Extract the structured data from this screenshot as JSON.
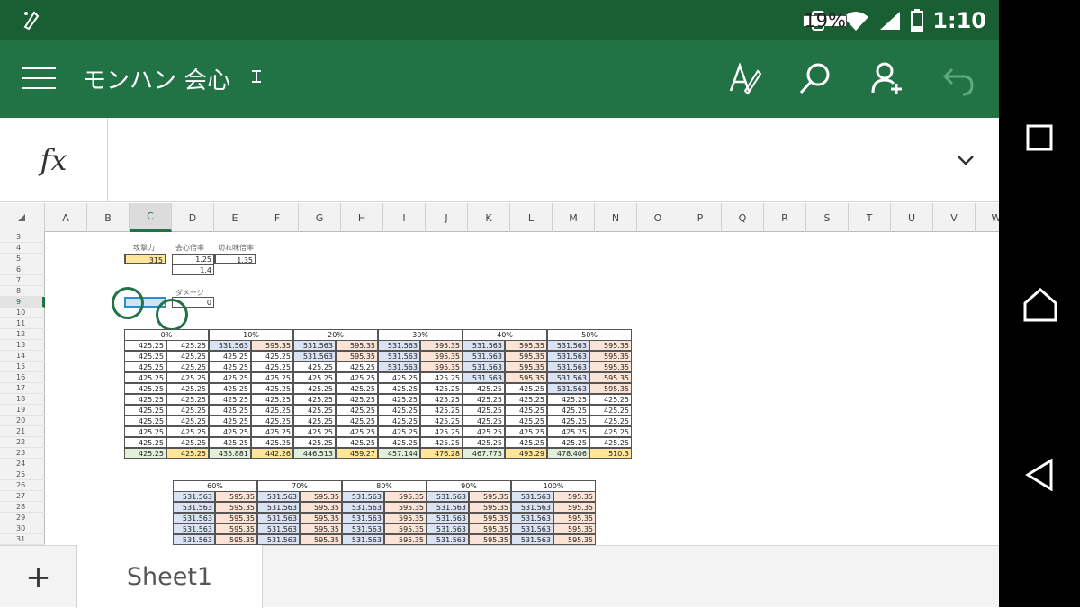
{
  "status_bar": {
    "battery_percent": "19%",
    "time": "1:10"
  },
  "app_bar": {
    "title": "モンハン 会心",
    "title_icon": "text-cursor-icon"
  },
  "toolbar": {
    "icons": [
      "draw-pen-icon",
      "search-icon",
      "share-person-icon",
      "undo-icon"
    ]
  },
  "formula_bar": {
    "fx_label": "fx",
    "value": ""
  },
  "grid": {
    "selected_column": "C",
    "selected_row": "9",
    "columns": [
      "A",
      "B",
      "C",
      "D",
      "E",
      "F",
      "G",
      "H",
      "I",
      "J",
      "K",
      "L",
      "M",
      "N",
      "O",
      "P",
      "Q",
      "R",
      "S",
      "T",
      "U",
      "V",
      "W"
    ],
    "rows": [
      "3",
      "4",
      "5",
      "6",
      "7",
      "8",
      "9",
      "10",
      "11",
      "12",
      "13",
      "14",
      "15",
      "16",
      "17",
      "18",
      "19",
      "20",
      "21",
      "22",
      "23",
      "24",
      "25",
      "26",
      "27",
      "28",
      "29",
      "30",
      "31"
    ],
    "labels": {
      "attack": "攻撃力",
      "crit_rate": "会心倍率",
      "sharp_rate": "切れ味倍率",
      "damage": "ダメージ"
    },
    "inputs": {
      "attack": "315",
      "crit_rate": "1.25",
      "sharp_rate": "1.35",
      "d6": "1.4",
      "damage": "0"
    },
    "table1": {
      "headers": [
        "0%",
        "10%",
        "20%",
        "30%",
        "40%",
        "50%"
      ],
      "rows": [
        [
          "425.25",
          "425.25",
          "531.563",
          "595.35",
          "531.563",
          "595.35",
          "531.563",
          "595.35",
          "531.563",
          "595.35",
          "531.563",
          "595.35"
        ],
        [
          "425.25",
          "425.25",
          "425.25",
          "425.25",
          "531.563",
          "595.35",
          "531.563",
          "595.35",
          "531.563",
          "595.35",
          "531.563",
          "595.35"
        ],
        [
          "425.25",
          "425.25",
          "425.25",
          "425.25",
          "425.25",
          "425.25",
          "531.563",
          "595.35",
          "531.563",
          "595.35",
          "531.563",
          "595.35"
        ],
        [
          "425.25",
          "425.25",
          "425.25",
          "425.25",
          "425.25",
          "425.25",
          "425.25",
          "425.25",
          "531.563",
          "595.35",
          "531.563",
          "595.35"
        ],
        [
          "425.25",
          "425.25",
          "425.25",
          "425.25",
          "425.25",
          "425.25",
          "425.25",
          "425.25",
          "425.25",
          "425.25",
          "531.563",
          "595.35"
        ],
        [
          "425.25",
          "425.25",
          "425.25",
          "425.25",
          "425.25",
          "425.25",
          "425.25",
          "425.25",
          "425.25",
          "425.25",
          "425.25",
          "425.25"
        ],
        [
          "425.25",
          "425.25",
          "425.25",
          "425.25",
          "425.25",
          "425.25",
          "425.25",
          "425.25",
          "425.25",
          "425.25",
          "425.25",
          "425.25"
        ],
        [
          "425.25",
          "425.25",
          "425.25",
          "425.25",
          "425.25",
          "425.25",
          "425.25",
          "425.25",
          "425.25",
          "425.25",
          "425.25",
          "425.25"
        ],
        [
          "425.25",
          "425.25",
          "425.25",
          "425.25",
          "425.25",
          "425.25",
          "425.25",
          "425.25",
          "425.25",
          "425.25",
          "425.25",
          "425.25"
        ],
        [
          "425.25",
          "425.25",
          "425.25",
          "425.25",
          "425.25",
          "425.25",
          "425.25",
          "425.25",
          "425.25",
          "425.25",
          "425.25",
          "425.25"
        ],
        [
          "425.25",
          "425.25",
          "435.881",
          "442.26",
          "446.513",
          "459.27",
          "457.144",
          "476.28",
          "467.775",
          "493.29",
          "478.406",
          "510.3"
        ]
      ],
      "colors": [
        [
          "",
          "",
          "blue",
          "orange",
          "blue",
          "orange",
          "blue",
          "orange",
          "blue",
          "orange",
          "blue",
          "orange"
        ],
        [
          "",
          "",
          "",
          "",
          "blue",
          "orange",
          "blue",
          "orange",
          "blue",
          "orange",
          "blue",
          "orange"
        ],
        [
          "",
          "",
          "",
          "",
          "",
          "",
          "blue",
          "orange",
          "blue",
          "orange",
          "blue",
          "orange"
        ],
        [
          "",
          "",
          "",
          "",
          "",
          "",
          "",
          "",
          "blue",
          "orange",
          "blue",
          "orange"
        ],
        [
          "",
          "",
          "",
          "",
          "",
          "",
          "",
          "",
          "",
          "",
          "blue",
          "orange"
        ],
        [
          "",
          "",
          "",
          "",
          "",
          "",
          "",
          "",
          "",
          "",
          "",
          ""
        ],
        [
          "",
          "",
          "",
          "",
          "",
          "",
          "",
          "",
          "",
          "",
          "",
          ""
        ],
        [
          "",
          "",
          "",
          "",
          "",
          "",
          "",
          "",
          "",
          "",
          "",
          ""
        ],
        [
          "",
          "",
          "",
          "",
          "",
          "",
          "",
          "",
          "",
          "",
          "",
          ""
        ],
        [
          "",
          "",
          "",
          "",
          "",
          "",
          "",
          "",
          "",
          "",
          "",
          ""
        ],
        [
          "green",
          "yellow",
          "green",
          "yellow",
          "green",
          "yellow",
          "green",
          "yellow",
          "green",
          "yellow",
          "green",
          "yellow"
        ]
      ]
    },
    "table2": {
      "headers": [
        "60%",
        "70%",
        "80%",
        "90%",
        "100%"
      ],
      "rows": [
        [
          "531.563",
          "595.35",
          "531.563",
          "595.35",
          "531.563",
          "595.35",
          "531.563",
          "595.35",
          "531.563",
          "595.35"
        ],
        [
          "531.563",
          "595.35",
          "531.563",
          "595.35",
          "531.563",
          "595.35",
          "531.563",
          "595.35",
          "531.563",
          "595.35"
        ],
        [
          "531.563",
          "595.35",
          "531.563",
          "595.35",
          "531.563",
          "595.35",
          "531.563",
          "595.35",
          "531.563",
          "595.35"
        ],
        [
          "531.563",
          "595.35",
          "531.563",
          "595.35",
          "531.563",
          "595.35",
          "531.563",
          "595.35",
          "531.563",
          "595.35"
        ],
        [
          "531.563",
          "595.35",
          "531.563",
          "595.35",
          "531.563",
          "595.35",
          "531.563",
          "595.35",
          "531.563",
          "595.35"
        ]
      ]
    }
  },
  "sheet_tabs": {
    "add_label": "+",
    "tabs": [
      "Sheet1"
    ]
  },
  "colors": {
    "status_bar": "#1a5e34",
    "app_bar": "#217346",
    "cell_blue": "#dae3f3",
    "cell_orange": "#fbe4d5",
    "cell_green": "#e2efda",
    "cell_yellow": "#ffe699"
  }
}
